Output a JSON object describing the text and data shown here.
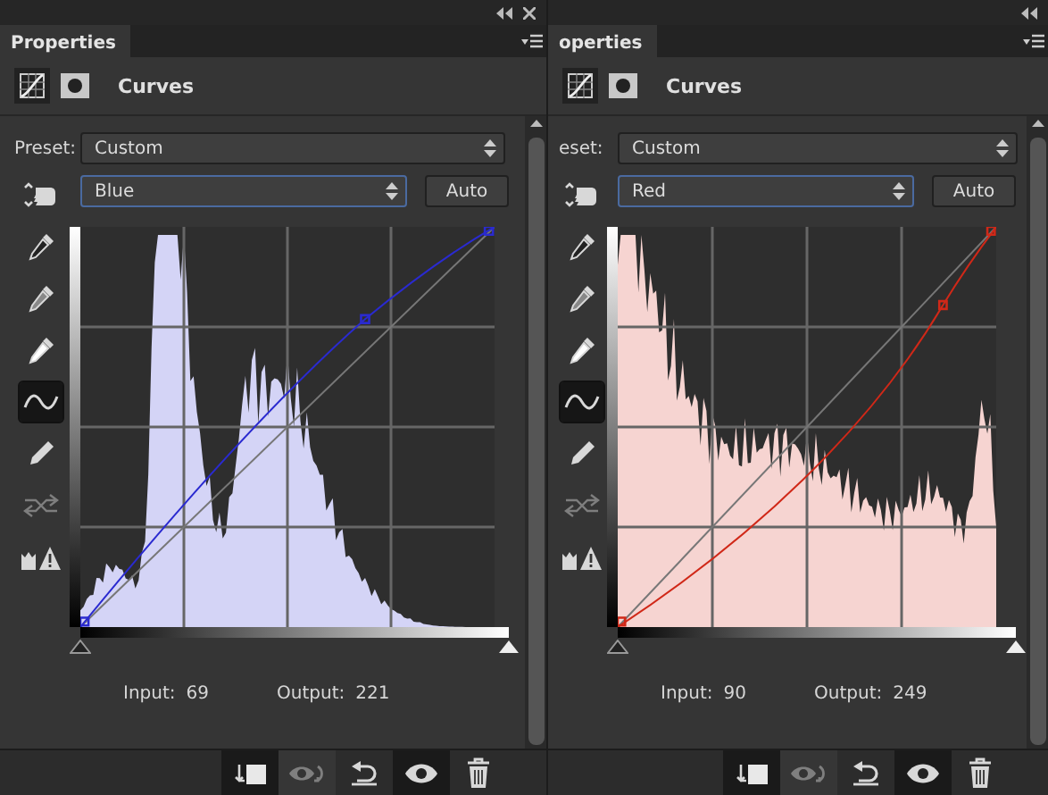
{
  "panels": [
    {
      "tab": "Properties",
      "title": "Curves",
      "preset_label": "Preset:",
      "preset": "Custom",
      "channel": "Blue",
      "channel_focused": true,
      "auto": "Auto",
      "color": "#2a2ad0",
      "input_label": "Input:",
      "input": "69",
      "output_label": "Output:",
      "output": "221",
      "tools": [
        {
          "kind": "hand",
          "selected": false,
          "disabled": false
        },
        {
          "kind": "dropper-black",
          "selected": false,
          "disabled": false
        },
        {
          "kind": "dropper-gray",
          "selected": false,
          "disabled": false
        },
        {
          "kind": "dropper-white",
          "selected": false,
          "disabled": false
        },
        {
          "kind": "curve",
          "selected": true,
          "disabled": false
        },
        {
          "kind": "pencil",
          "selected": false,
          "disabled": false
        },
        {
          "kind": "smooth",
          "selected": false,
          "disabled": true
        },
        {
          "kind": "clip-warning",
          "selected": false,
          "disabled": false
        }
      ],
      "sliders": [
        {
          "kind": "shadow",
          "level": 0
        },
        {
          "kind": "highlight",
          "level": 1
        }
      ],
      "footer_buttons": [
        {
          "kind": "clip",
          "disabled": false,
          "on": true
        },
        {
          "kind": "previous",
          "disabled": true,
          "on": false
        },
        {
          "kind": "reset",
          "disabled": false,
          "on": false
        },
        {
          "kind": "visibility",
          "disabled": false,
          "on": true
        },
        {
          "kind": "delete",
          "disabled": false,
          "on": false
        }
      ]
    },
    {
      "tab": "operties",
      "title": "Curves",
      "preset_label": "eset:",
      "preset": "Custom",
      "channel": "Red",
      "channel_focused": true,
      "auto": "Auto",
      "color": "#d02818",
      "input_label": "Input:",
      "input": "90",
      "output_label": "Output:",
      "output": "249",
      "tools": [
        {
          "kind": "hand",
          "selected": false,
          "disabled": false
        },
        {
          "kind": "dropper-black",
          "selected": false,
          "disabled": false
        },
        {
          "kind": "dropper-gray",
          "selected": false,
          "disabled": false
        },
        {
          "kind": "dropper-white",
          "selected": false,
          "disabled": false
        },
        {
          "kind": "curve",
          "selected": true,
          "disabled": false
        },
        {
          "kind": "pencil",
          "selected": false,
          "disabled": false
        },
        {
          "kind": "smooth",
          "selected": false,
          "disabled": true
        },
        {
          "kind": "clip-warning",
          "selected": false,
          "disabled": false
        }
      ],
      "sliders": [
        {
          "kind": "shadow",
          "level": 0
        },
        {
          "kind": "highlight",
          "level": 1
        }
      ],
      "footer_buttons": [
        {
          "kind": "clip",
          "disabled": false,
          "on": true
        },
        {
          "kind": "previous",
          "disabled": true,
          "on": false
        },
        {
          "kind": "reset",
          "disabled": false,
          "on": false
        },
        {
          "kind": "visibility",
          "disabled": false,
          "on": true
        },
        {
          "kind": "delete",
          "disabled": false,
          "on": false
        }
      ]
    }
  ]
}
